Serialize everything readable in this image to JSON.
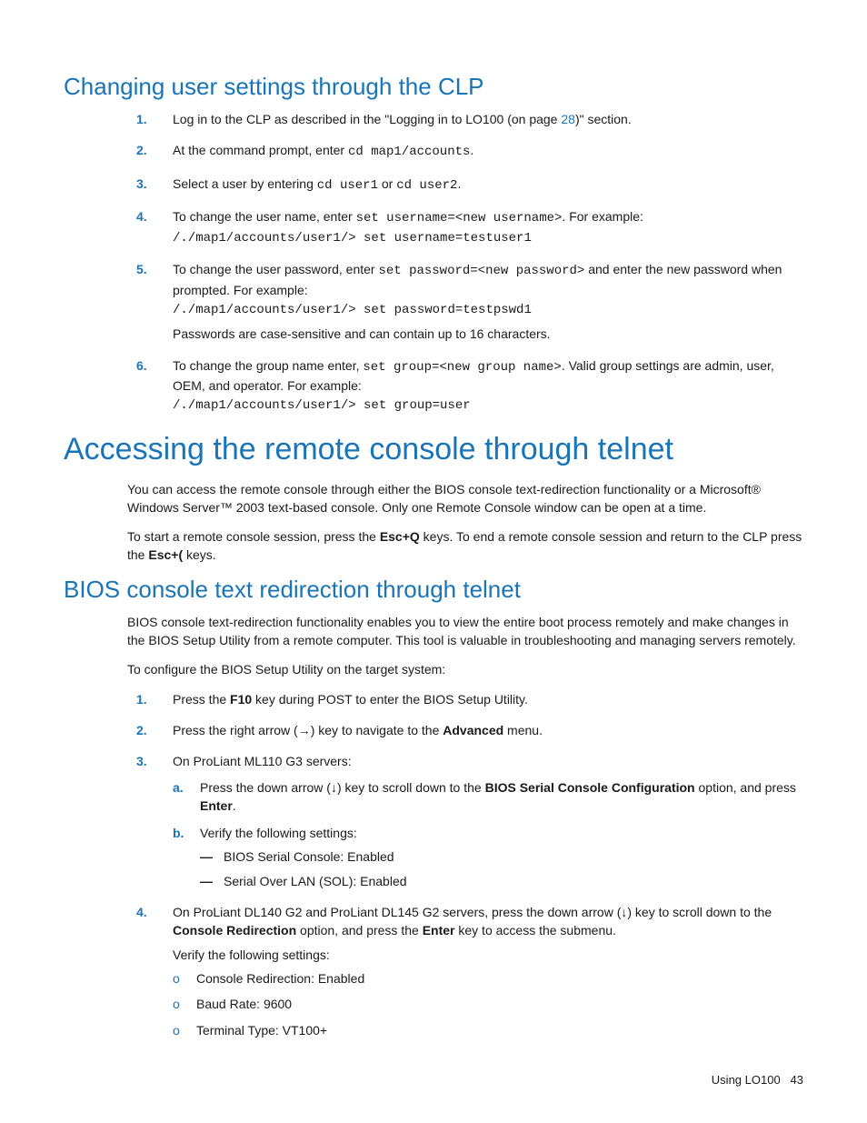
{
  "section1": {
    "heading": "Changing user settings through the CLP",
    "items": [
      {
        "marker": "1.",
        "pre": "Log in to the CLP as described in the \"Logging in to LO100 (on page ",
        "link": "28",
        "post": ")\" section."
      },
      {
        "marker": "2.",
        "pre": "At the command prompt, enter ",
        "code": "cd map1/accounts",
        "post": "."
      },
      {
        "marker": "3.",
        "pre": "Select a user by entering ",
        "code1": "cd user1",
        "mid": " or ",
        "code2": "cd user2",
        "post": "."
      },
      {
        "marker": "4.",
        "pre": "To change the user name, enter ",
        "code1": "set username=<new username>",
        "mid": ". For example:",
        "code_line": "/./map1/accounts/user1/> set username=testuser1"
      },
      {
        "marker": "5.",
        "pre": "To change the user password, enter ",
        "code1": "set password=<new password>",
        "mid": " and enter the new password when prompted. For example:",
        "code_line": "/./map1/accounts/user1/> set password=testpswd1",
        "note": "Passwords are case-sensitive and can contain up to 16 characters."
      },
      {
        "marker": "6.",
        "pre": "To change the group name enter, ",
        "code1": "set group=<new group name>",
        "mid": ". Valid group settings are admin, user, OEM, and operator. For example:",
        "code_line": "/./map1/accounts/user1/> set group=user"
      }
    ]
  },
  "section2": {
    "heading": "Accessing the remote console through telnet",
    "para1": "You can access the remote console through either the BIOS console text-redirection functionality or a Microsoft® Windows Server™ 2003 text-based console. Only one Remote Console window can be open at a time.",
    "para2_pre": "To start a remote console session, press the ",
    "para2_b1": "Esc+Q",
    "para2_mid": " keys. To end a remote console session and return to the CLP press the ",
    "para2_b2": "Esc+(",
    "para2_post": " keys."
  },
  "section3": {
    "heading": "BIOS console text redirection through telnet",
    "para1": "BIOS console text-redirection functionality enables you to view the entire boot process remotely and make changes in the BIOS Setup Utility from a remote computer. This tool is valuable in troubleshooting and managing servers remotely.",
    "para2": "To configure the BIOS Setup Utility on the target system:",
    "items": [
      {
        "marker": "1.",
        "pre": "Press the ",
        "b": "F10",
        "post": " key during POST to enter the BIOS Setup Utility."
      },
      {
        "marker": "2.",
        "pre": "Press the right arrow (→) key to navigate to the ",
        "b": "Advanced",
        "post": " menu."
      },
      {
        "marker": "3.",
        "text": "On ProLiant ML110 G3 servers:",
        "sub": [
          {
            "marker": "a.",
            "pre": "Press the down arrow (↓) key to scroll down to the ",
            "b1": "BIOS Serial Console Configuration",
            "mid": " option, and press ",
            "b2": "Enter",
            "post": "."
          },
          {
            "marker": "b.",
            "text": "Verify the following settings:",
            "dash": [
              "BIOS Serial Console: Enabled",
              "Serial Over LAN (SOL): Enabled"
            ]
          }
        ]
      },
      {
        "marker": "4.",
        "pre": "On ProLiant DL140 G2 and ProLiant DL145 G2 servers, press the down arrow (↓) key to scroll down to the ",
        "b1": "Console Redirection",
        "mid": " option, and press the ",
        "b2": "Enter",
        "post": " key to access the submenu.",
        "verify": "Verify the following settings:",
        "circle": [
          "Console Redirection: Enabled",
          "Baud Rate: 9600",
          "Terminal Type: VT100+"
        ]
      }
    ]
  },
  "footer": {
    "label": "Using LO100",
    "page": "43"
  }
}
